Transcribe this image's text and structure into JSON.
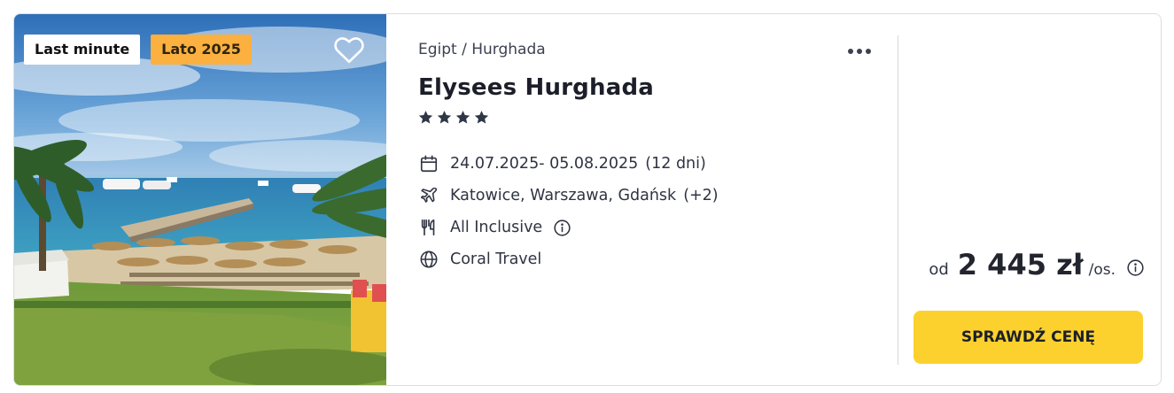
{
  "badges": {
    "last_minute": "Last minute",
    "season": "Lato 2025"
  },
  "offer": {
    "location": "Egipt / Hurghada",
    "hotel_name": "Elysees Hurghada",
    "stars": 4,
    "dates": "24.07.2025- 05.08.2025",
    "duration": "(12 dni)",
    "departure": "Katowice, Warszawa, Gdańsk",
    "departure_more": "(+2)",
    "board": "All Inclusive",
    "operator": "Coral Travel"
  },
  "price": {
    "prefix": "od",
    "amount": "2 445 zł",
    "suffix": "/os."
  },
  "cta_label": "SPRAWDŹ CENĘ",
  "icons": {
    "favorite": "heart-icon",
    "more": "more-dots-icon",
    "dates": "calendar-icon",
    "departure": "plane-icon",
    "board": "cutlery-icon",
    "operator": "globe-icon",
    "info": "info-icon",
    "star": "star-icon"
  },
  "colors": {
    "cta": "#fcd12e",
    "season_badge": "#fbb040",
    "text": "#1f2430"
  }
}
